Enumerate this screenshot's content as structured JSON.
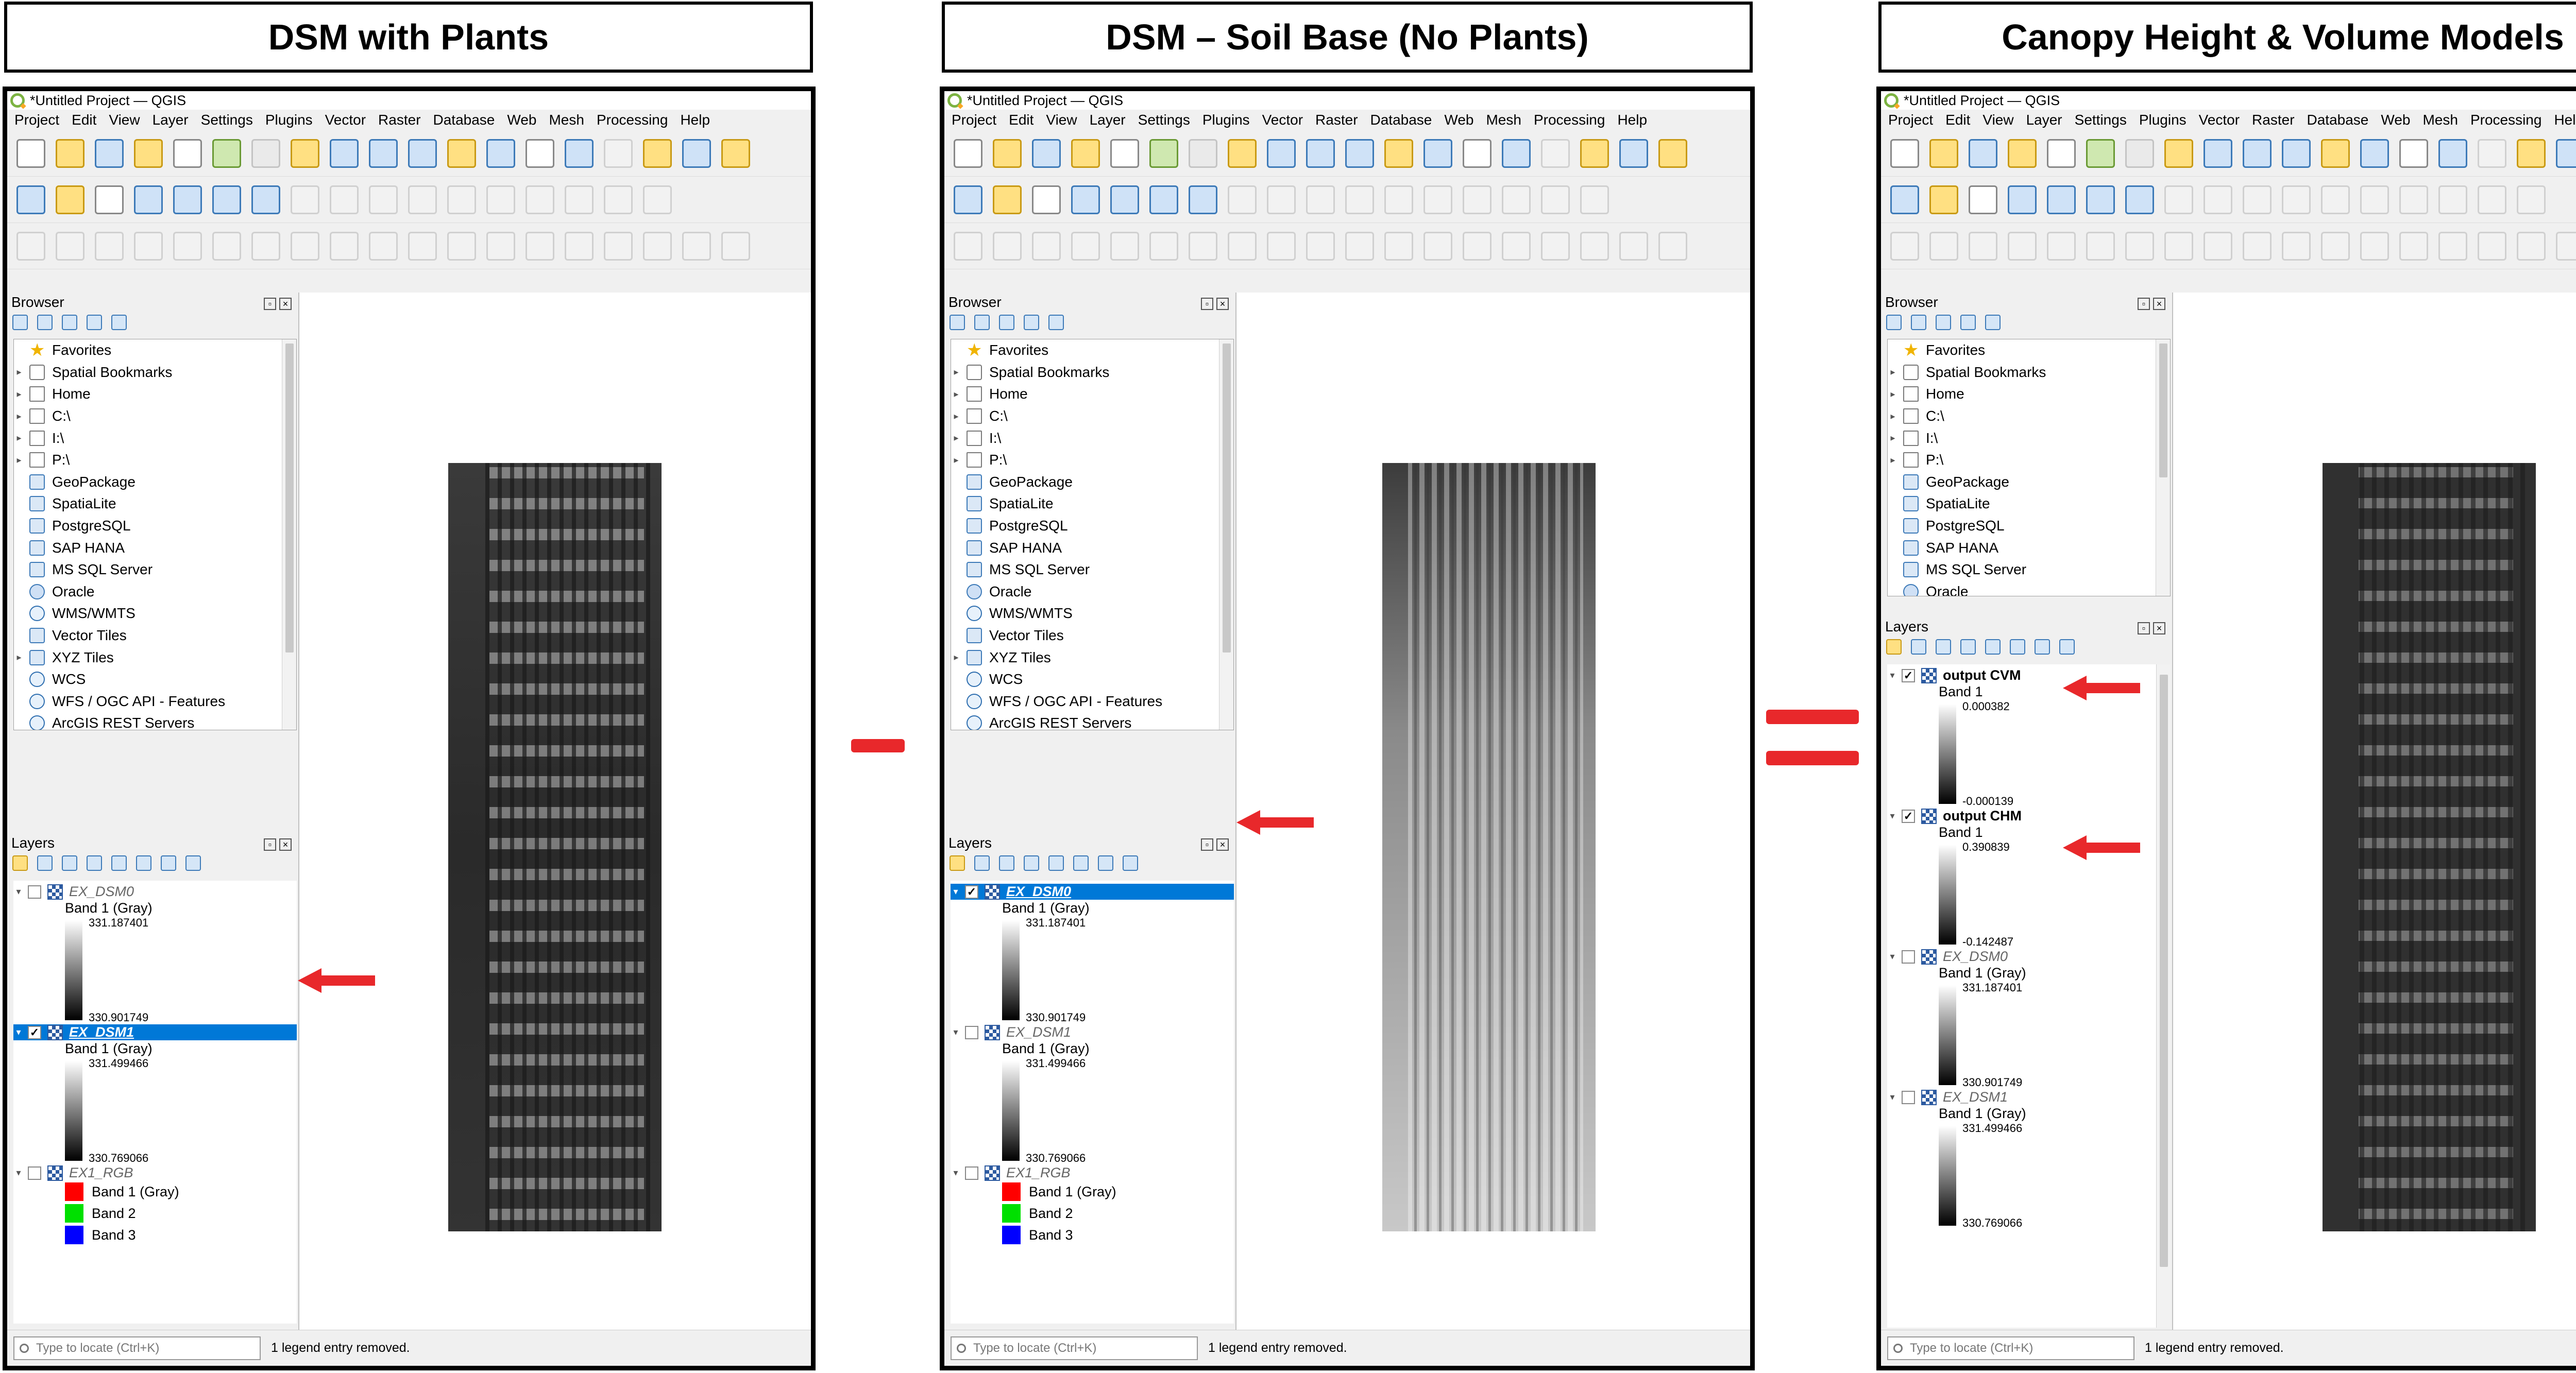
{
  "titles": [
    "DSM with Plants",
    "DSM – Soil Base (No Plants)",
    "Canopy Height & Volume Models"
  ],
  "window_title": "*Untitled Project — QGIS",
  "menu": [
    "Project",
    "Edit",
    "View",
    "Layer",
    "Settings",
    "Plugins",
    "Vector",
    "Raster",
    "Database",
    "Web",
    "Mesh",
    "Processing",
    "Help"
  ],
  "browser": {
    "title": "Browser",
    "items": [
      "Favorites",
      "Spatial Bookmarks",
      "Home",
      "C:\\",
      "I:\\",
      "P:\\",
      "GeoPackage",
      "SpatiaLite",
      "PostgreSQL",
      "SAP HANA",
      "MS SQL Server",
      "Oracle",
      "WMS/WMTS",
      "Vector Tiles",
      "XYZ Tiles",
      "WCS",
      "WFS / OGC API - Features",
      "ArcGIS REST Servers"
    ]
  },
  "layers_title": "Layers",
  "layers": {
    "dsm0": {
      "name": "EX_DSM0",
      "band": "Band 1 (Gray)",
      "max": "331.187401",
      "min": "330.901749"
    },
    "dsm1": {
      "name": "EX_DSM1",
      "band": "Band 1 (Gray)",
      "max": "331.499466",
      "min": "330.769066"
    },
    "rgb": {
      "name": "EX1_RGB",
      "bands": [
        "Band 1 (Gray)",
        "Band 2",
        "Band 3"
      ],
      "colors": [
        "#ff0000",
        "#00e000",
        "#0000ff"
      ]
    },
    "cvm": {
      "name": "output CVM",
      "band": "Band 1",
      "max": "0.000382",
      "min": "-0.000139"
    },
    "chm": {
      "name": "output CHM",
      "band": "Band 1",
      "max": "0.390839",
      "min": "-0.142487"
    }
  },
  "status": {
    "locator_placeholder": "Type to locate (Ctrl+K)",
    "message": "1 legend entry removed."
  },
  "colors": {
    "selection": "#0078d7",
    "arrow": "#e8282b",
    "operator": "#e8282b"
  }
}
